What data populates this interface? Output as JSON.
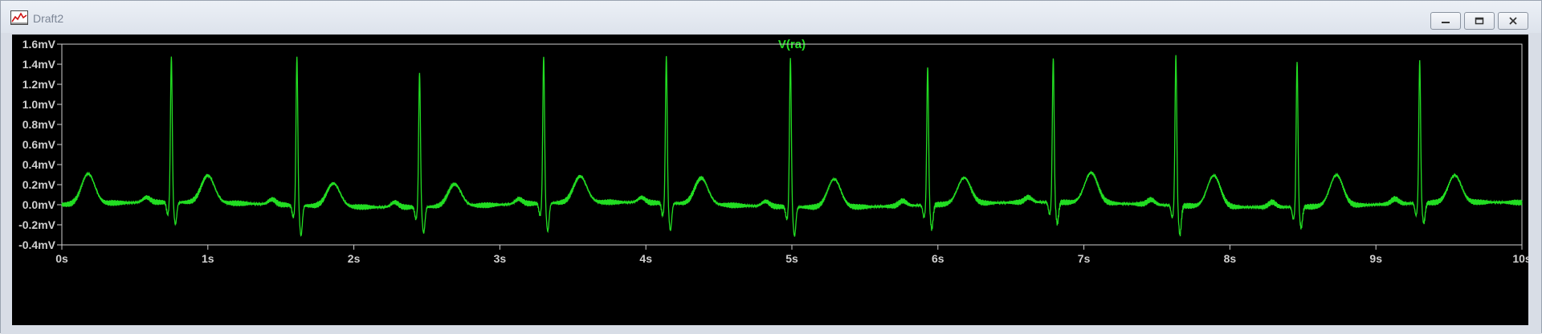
{
  "window": {
    "title": "Draft2",
    "icon": "waveform-icon",
    "buttons": {
      "minimize": "minimize-icon",
      "restore": "restore-icon",
      "close": "close-icon"
    }
  },
  "colors": {
    "background": "#000000",
    "trace": "#22dd22",
    "axis_text": "#d0d0d0",
    "frame": "#cfcfcf"
  },
  "chart_data": {
    "type": "line",
    "title": "V(ra)",
    "xlabel": "",
    "ylabel": "",
    "xlim": [
      0,
      10
    ],
    "ylim": [
      -0.4,
      1.6
    ],
    "x_ticks": [
      "0s",
      "1s",
      "2s",
      "3s",
      "4s",
      "5s",
      "6s",
      "7s",
      "8s",
      "9s",
      "10s"
    ],
    "y_ticks": [
      "1.6mV",
      "1.4mV",
      "1.2mV",
      "1.0mV",
      "0.8mV",
      "0.6mV",
      "0.4mV",
      "0.2mV",
      "0.0mV",
      "-0.2mV",
      "-0.4mV"
    ],
    "grid": false,
    "series": [
      {
        "name": "V(ra)",
        "r_peak_times_s": [
          0.75,
          1.61,
          2.45,
          3.3,
          4.14,
          4.99,
          5.93,
          6.79,
          7.63,
          8.46,
          9.3
        ],
        "r_peak_values_mV": [
          1.45,
          1.48,
          1.34,
          1.47,
          1.46,
          1.48,
          1.38,
          1.44,
          1.49,
          1.45,
          1.42
        ],
        "t_wave_times_s": [
          0.18,
          1.0,
          1.86,
          2.69,
          3.55,
          4.38,
          5.29,
          6.18,
          7.05,
          7.89,
          8.73,
          9.54
        ],
        "t_wave_values_mV": [
          0.3,
          0.27,
          0.23,
          0.22,
          0.26,
          0.26,
          0.28,
          0.26,
          0.3,
          0.31,
          0.31,
          0.27
        ],
        "s_wave_values_mV": [
          -0.22,
          -0.3,
          -0.26,
          -0.28,
          -0.27,
          -0.29,
          -0.24,
          -0.21,
          -0.29,
          -0.21,
          -0.2
        ],
        "baseline_mV": 0.0,
        "noise_amplitude_mV": 0.03
      }
    ]
  }
}
